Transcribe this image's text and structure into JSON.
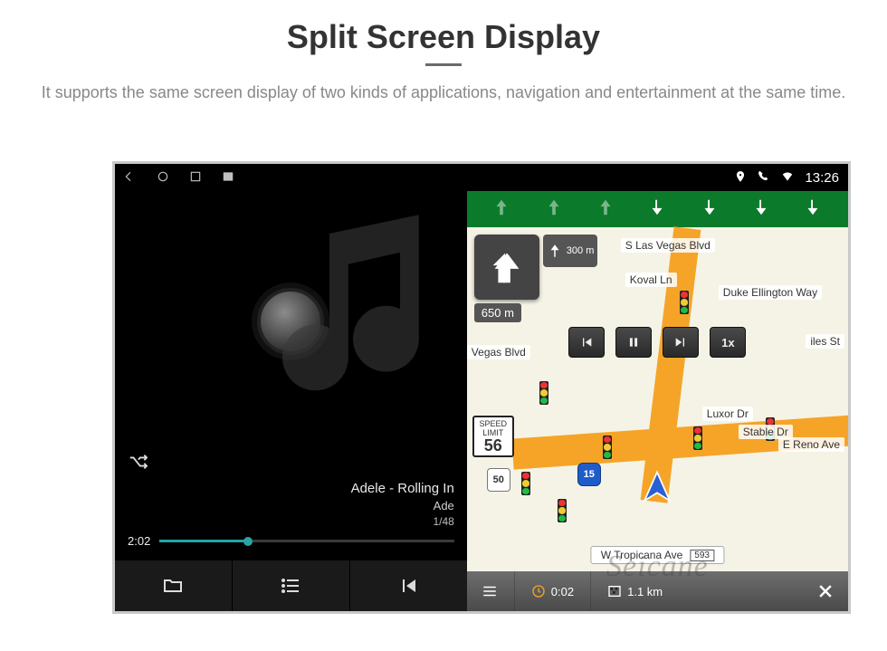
{
  "header": {
    "title": "Split Screen Display",
    "subtitle": "It supports the same screen display of two kinds of applications, navigation and entertainment at the same time."
  },
  "statusbar": {
    "time": "13:26"
  },
  "music": {
    "track": "Adele - Rolling In",
    "artist": "Ade",
    "count": "1/48",
    "elapsed": "2:02"
  },
  "map": {
    "turn_distance": "650 m",
    "next_distance": "300 m",
    "speed_label": "SPEED LIMIT",
    "speed_value": "56",
    "shield_50": "50",
    "shield_15": "15",
    "speed_btn": "1x",
    "streets": {
      "s_las_vegas": "S Las Vegas Blvd",
      "koval": "Koval Ln",
      "duke": "Duke Ellington Way",
      "giles": "iles St",
      "luxor": "Luxor Dr",
      "stable": "Stable Dr",
      "reno": "E Reno Ave",
      "vegas_blvd": "Vegas Blvd",
      "tropicana": "W Tropicana Ave",
      "trop_num": "593"
    },
    "footer": {
      "time": "0:02",
      "dist": "1.1 km"
    }
  },
  "watermark": "Seicane"
}
